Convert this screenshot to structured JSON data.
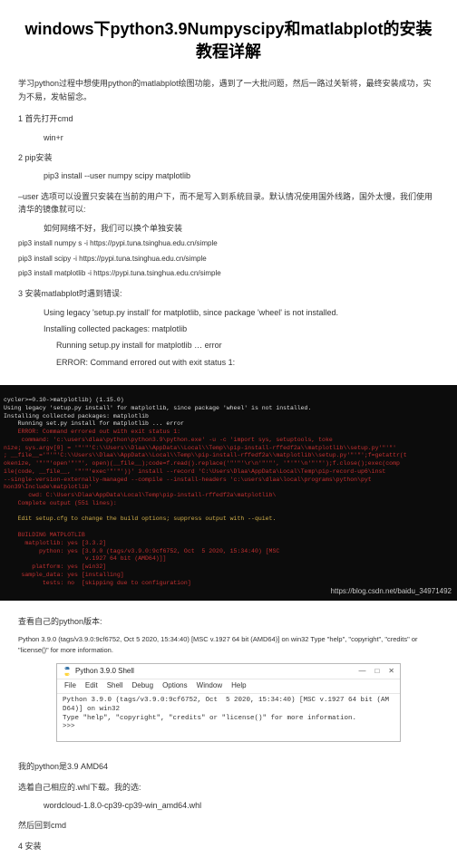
{
  "title": "windows下python3.9Numpyscipy和matlabplot的安装教程详解",
  "intro": "学习python过程中想使用python的matlabplot绘图功能，遇到了一大批问题，然后一路过关斩将，最终安装成功，实为不易，发帖留念。",
  "s1": {
    "head": "1 首先打开cmd",
    "item": "win+r"
  },
  "s2": {
    "head": "2 pip安装",
    "cmd": "pip3 install --user numpy scipy matplotlib",
    "note": "–user 选项可以设置只安装在当前的用户下，而不是写入到系统目录。默认情况使用国外线路，国外太慢，我们使用清华的镜像就可以:",
    "alt": "如何网络不好，我们可以换个单独安装",
    "pip1": "pip3 install numpy s -i https://pypi.tuna.tsinghua.edu.cn/simple",
    "pip2": "pip3 install scipy -i https://pypi.tuna.tsinghua.edu.cn/simple",
    "pip3": "pip3 install matplotlib -i https://pypi.tuna.tsinghua.edu.cn/simple"
  },
  "s3": {
    "head": "3 安装matlabplot时遇到错误:",
    "e1": "Using legacy 'setup.py install' for matplotlib, since package 'wheel' is not installed.",
    "e2": "Installing collected packages: matplotlib",
    "e3": "Running setup.py install for matplotlib … error",
    "e4": "ERROR: Command errored out with exit status 1:"
  },
  "terminal": {
    "l1": "cycler>=0.10->matplotlib) (1.15.0)",
    "l2": "Using legacy 'setup.py install' for matplotlib, since package 'wheel' is not installed.",
    "l3": "Installing collected packages: matplotlib",
    "l4": "    Running set.py install for matplotlib ... error",
    "r1": "    ERROR: Command errored out with exit status 1:",
    "r2": "     command: 'c:\\users\\dlaa\\python\\python3.9\\python.exe' -u -c 'import sys, setuptools, toke",
    "r3": "nize; sys.argv[0] = '\"'\"'C:\\\\Users\\\\Dlaa\\\\AppData\\\\Local\\\\Temp\\\\pip-install-rffedf2a\\\\matplotlib\\\\setup.py'\"'\"'",
    "r4": "; __file__='\"'\"'C:\\\\Users\\\\Dlaa\\\\AppData\\\\Local\\\\Temp\\\\pip-install-rffedf2a\\\\matplotlib\\\\setup.py'\"'\"';f=getattr(t",
    "r5": "okenize, '\"'\"'open'\"'\"', open)(__file__);code=f.read().replace('\"'\"'\\r\\n'\"'\"', '\"'\"'\\n'\"'\"');f.close();exec(comp",
    "r6": "ile(code, __file__, '\"'\"'exec'\"'\"'))' install --record 'C:\\Users\\Dlaa\\AppData\\Local\\Temp\\pip-record-up6\\inst",
    "r7": "--single-version-externally-managed --compile --install-headers 'c:\\users\\dlaa\\local\\programs\\python\\pyt",
    "r8": "hon39\\Include\\matplotlib'",
    "r9": "       cwd: C:\\Users\\Dlaa\\AppData\\Local\\Temp\\pip-install-rffedf2a\\matplotlib\\",
    "r10": "    Complete output (551 lines):",
    "y1": "    Edit setup.cfg to change the build options; suppress output with --quiet.",
    "b1": "    BUILDING MATPLOTLIB",
    "b2": "      matplotlib: yes [3.3.2]",
    "b3": "          python: yes [3.9.0 (tags/v3.9.0:9cf6752, Oct  5 2020, 15:34:40) [MSC",
    "b4": "                       v.1927 64 bit (AMD64)]]",
    "b5": "        platform: yes [win32]",
    "b6": "     sample_data: yes [installing]",
    "b7": "           tests: no  [skipping due to configuration]",
    "watermark": "https://blog.csdn.net/baidu_34971492"
  },
  "after_term": {
    "l1": "查看自己的python版本:",
    "l2": "Python 3.9.0 (tags/v3.9.0:9cf6752, Oct 5 2020, 15:34:40) [MSC v.1927 64 bit (AMD64)] on win32 Type \"help\", \"copyright\", \"credits\" or \"license()\" for more information."
  },
  "idle": {
    "title": "Python 3.9.0 Shell",
    "menu": [
      "File",
      "Edit",
      "Shell",
      "Debug",
      "Options",
      "Window",
      "Help"
    ],
    "body_l1": "Python 3.9.0 (tags/v3.9.0:9cf6752, Oct  5 2020, 15:34:40) [MSC v.1927 64 bit (AM",
    "body_l2": "D64)] on win32",
    "body_l3": "Type \"help\", \"copyright\", \"credits\" or \"license()\" for more information.",
    "prompt": ">>> ",
    "winbtns": {
      "min": "—",
      "max": "□",
      "close": "✕"
    }
  },
  "tail": {
    "l1": "我的python是3.9 AMD64",
    "l2": "选着自己相应的.whl下载。我的选:",
    "l3": "wordcloud‑1.8.0‑cp39‑cp39‑win_amd64.whl",
    "l4": "然后回到cmd",
    "l5": "4 安装"
  }
}
